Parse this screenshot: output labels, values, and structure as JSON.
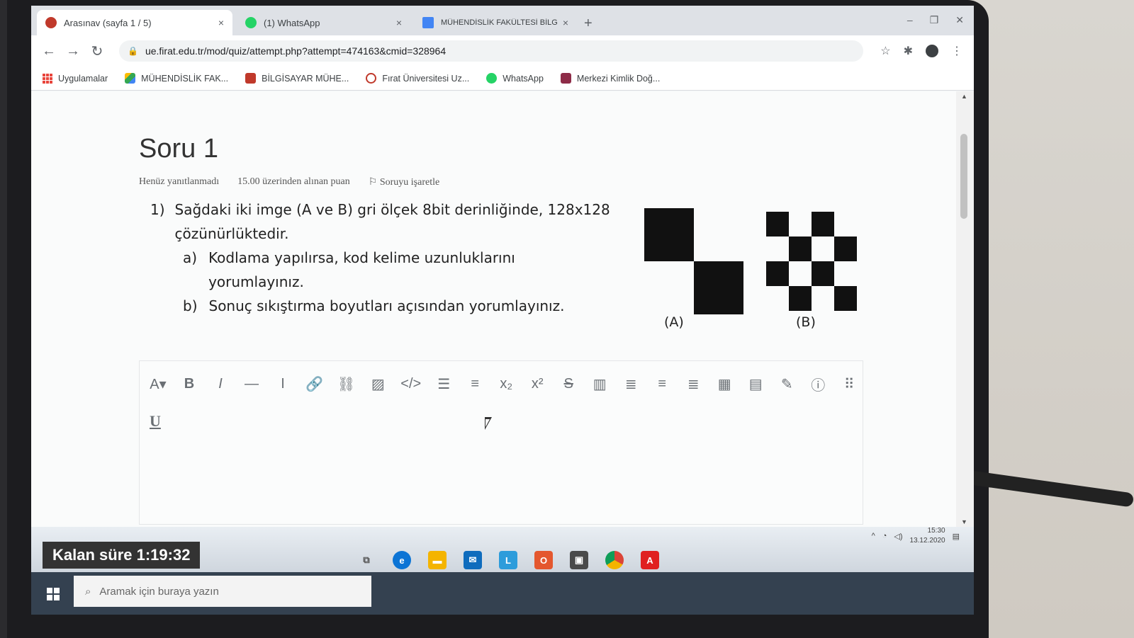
{
  "browser": {
    "tabs": [
      {
        "title": "Arasınav (sayfa 1 / 5)",
        "close": "×",
        "icon_color": "#c0392b",
        "active": true
      },
      {
        "title": "(1) WhatsApp",
        "close": "×",
        "icon_color": "#25d366",
        "active": false
      },
      {
        "title": "MÜHENDİSLİK FAKÜLTESİ BİLGİS...",
        "close": "×",
        "icon_color": "#4285f4",
        "active": false
      }
    ],
    "new_tab": "+",
    "url": "ue.firat.edu.tr/mod/quiz/attempt.php?attempt=474163&cmid=328964",
    "bookmarks": [
      {
        "label": "Uygulamalar",
        "icon": "apps-grid-icon",
        "color": "#e8453c"
      },
      {
        "label": "MÜHENDİSLİK FAK...",
        "icon": "drive-icon",
        "color": "#fbbc04"
      },
      {
        "label": "BİLGİSAYAR MÜHE...",
        "icon": "bookmark-red-icon",
        "color": "#c0392b"
      },
      {
        "label": "Fırat Üniversitesi Uz...",
        "icon": "firat-icon",
        "color": "#c0392b"
      },
      {
        "label": "WhatsApp",
        "icon": "whatsapp-icon",
        "color": "#25d366"
      },
      {
        "label": "Merkezi Kimlik Doğ...",
        "icon": "kimlik-icon",
        "color": "#8e2c48"
      }
    ]
  },
  "question": {
    "title": "Soru 1",
    "status": "Henüz yanıtlanmadı",
    "points": "15.00 üzerinden alınan puan",
    "flag": "Soruyu işaretle",
    "number": "1)",
    "text": "Sağdaki iki imge (A ve B) gri ölçek 8bit derinliğinde, 128x128 çözünürlüktedir.",
    "parts": [
      {
        "label": "a)",
        "text": "Kodlama yapılırsa, kod kelime uzunluklarını yorumlayınız."
      },
      {
        "label": "b)",
        "text": "Sonuç sıkıştırma boyutları açısından yorumlayınız."
      }
    ],
    "figure_a_caption": "(A)",
    "figure_b_caption": "(B)",
    "figure_b_pattern": [
      [
        1,
        0,
        1,
        0
      ],
      [
        0,
        1,
        0,
        1
      ],
      [
        1,
        0,
        1,
        0
      ],
      [
        0,
        1,
        0,
        1
      ]
    ]
  },
  "editor": {
    "toolbar": [
      "A▾",
      "B",
      "I",
      "—",
      "I",
      "link-icon",
      "unlink-icon",
      "image-icon",
      "</>",
      "bullet-list-icon",
      "numbered-list-icon",
      "x₂",
      "x²",
      "S",
      "table-col-icon",
      "align-left-icon",
      "align-center-icon",
      "align-right-icon",
      "table-icon",
      "table-edit-icon",
      "edit-icon",
      "accessibility-icon",
      "more-icon"
    ],
    "underline": "U"
  },
  "timer": "Kalan süre 1:19:32",
  "taskbar": {
    "search_placeholder": "Aramak için buraya yazın",
    "time": "15:30",
    "date": "13.12.2020"
  }
}
